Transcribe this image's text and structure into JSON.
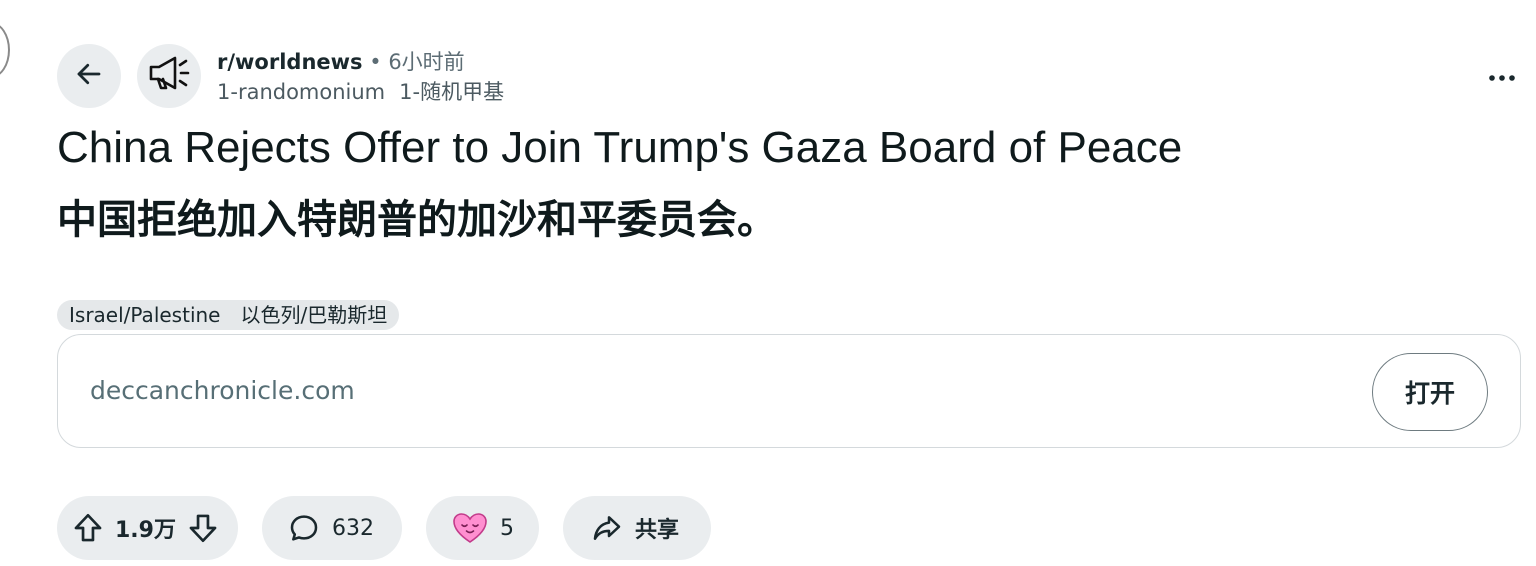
{
  "post": {
    "subreddit": "r/worldnews",
    "separator": "•",
    "time": "6小时前",
    "author": "1-randomonium",
    "author_translated": "1-随机甲基",
    "title_en": "China Rejects Offer to Join Trump's Gaza Board of Peace",
    "title_zh": "中国拒绝加入特朗普的加沙和平委员会。",
    "flair": "Israel/Palestine",
    "flair_translated": "以色列/巴勒斯坦"
  },
  "link": {
    "domain": "deccanchronicle.com",
    "open_label": "打开"
  },
  "actions": {
    "votes": "1.9万",
    "comments": "632",
    "awards": "5",
    "share_label": "共享"
  },
  "icons": {
    "back": "arrow-left-icon",
    "subreddit": "megaphone-icon",
    "more": "ellipsis-icon",
    "upvote": "arrow-up-icon",
    "downvote": "arrow-down-icon",
    "comment": "speech-bubble-icon",
    "award": "heart-face-icon",
    "share": "share-arrow-icon"
  },
  "colors": {
    "text_primary": "#0f1a1c",
    "text_secondary": "#576f76",
    "pill_background": "#eaedef",
    "border": "#d4d9dc"
  }
}
